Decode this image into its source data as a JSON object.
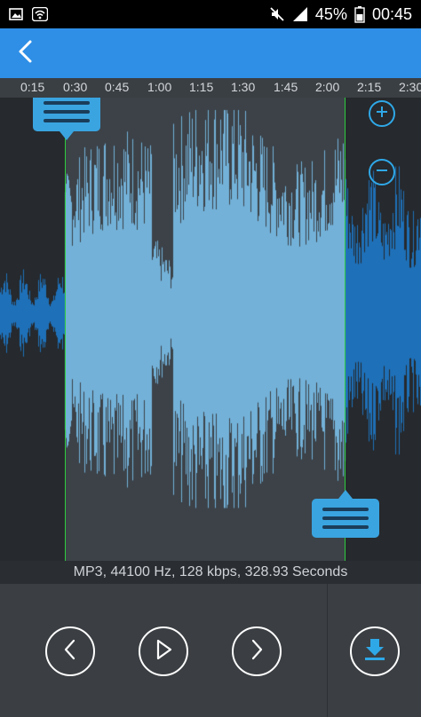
{
  "status_bar": {
    "battery": "45%",
    "time": "00:45",
    "icons": [
      "gallery-icon",
      "wifi-icon",
      "mute-icon",
      "signal-icon",
      "battery-icon"
    ]
  },
  "app_bar": {
    "back_icon": "chevron-left-icon",
    "color": "#2f8fe6"
  },
  "timeline": {
    "ticks": [
      "0:15",
      "0:30",
      "0:45",
      "1:00",
      "1:15",
      "1:30",
      "1:45",
      "2:00",
      "2:15",
      "2:30"
    ]
  },
  "info": {
    "text": "MP3, 44100 Hz, 128 kbps, 328.93 Seconds"
  },
  "controls": {
    "prev_icon": "chevron-left-icon",
    "play_icon": "play-icon",
    "next_icon": "chevron-right-icon",
    "save_icon": "download-icon"
  },
  "colors": {
    "wave_selected": "#7cc4f2",
    "wave_unselected": "#1e78c8",
    "marker": "#2ecc40",
    "accent": "#2fa8e8"
  }
}
